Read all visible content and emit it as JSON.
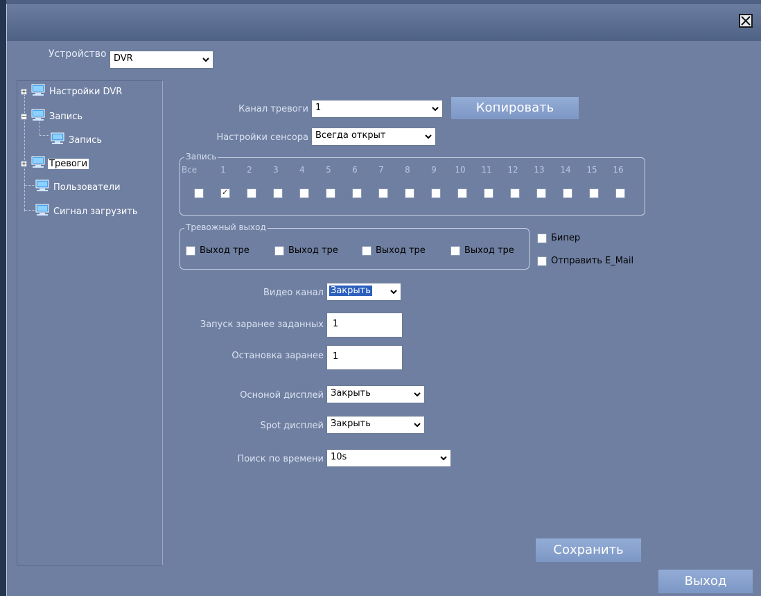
{
  "window": {
    "close_icon": "close-icon"
  },
  "device": {
    "label": "Устройство",
    "value": "DVR"
  },
  "tree": {
    "items": [
      {
        "label": "Настройки DVR",
        "expander": "+"
      },
      {
        "label": "Запись",
        "expander": "−"
      },
      {
        "label": "Запись",
        "expander": ""
      },
      {
        "label": "Тревоги",
        "expander": "+"
      },
      {
        "label": "Пользователи",
        "expander": ""
      },
      {
        "label": "Сигнал загрузить",
        "expander": ""
      }
    ]
  },
  "alarm_channel": {
    "label": "Канал тревоги",
    "value": "1"
  },
  "copy_button": "Копировать",
  "sensor_settings": {
    "label": "Настройки сенсора",
    "value": "Всегда открыт"
  },
  "record_group": {
    "title": "Запись",
    "all_label": "Все",
    "channels": [
      "1",
      "2",
      "3",
      "4",
      "5",
      "6",
      "7",
      "8",
      "9",
      "10",
      "11",
      "12",
      "13",
      "14",
      "15",
      "16"
    ],
    "checked": [
      false,
      true,
      false,
      false,
      false,
      false,
      false,
      false,
      false,
      false,
      false,
      false,
      false,
      false,
      false,
      false,
      false
    ]
  },
  "alarm_output_group": {
    "title": "Тревожный выход",
    "outputs": [
      "Выход тре",
      "Выход тре",
      "Выход тре",
      "Выход тре"
    ]
  },
  "beeper": "Бипер",
  "send_email": "Отправить E_Mail",
  "video_channel": {
    "label": "Видео канал",
    "value": "Закрыть"
  },
  "preset_start": {
    "label": "Запуск заранее заданных",
    "value": "1"
  },
  "preset_stop": {
    "label": "Остановка заранее",
    "value": "1"
  },
  "main_display": {
    "label": "Осноной дисплей",
    "value": "Закрыть"
  },
  "spot_display": {
    "label": "Spot дисплей",
    "value": "Закрыть"
  },
  "time_search": {
    "label": "Поиск по времени",
    "value": "10s"
  },
  "save_button": "Сохранить",
  "exit_button": "Выход"
}
